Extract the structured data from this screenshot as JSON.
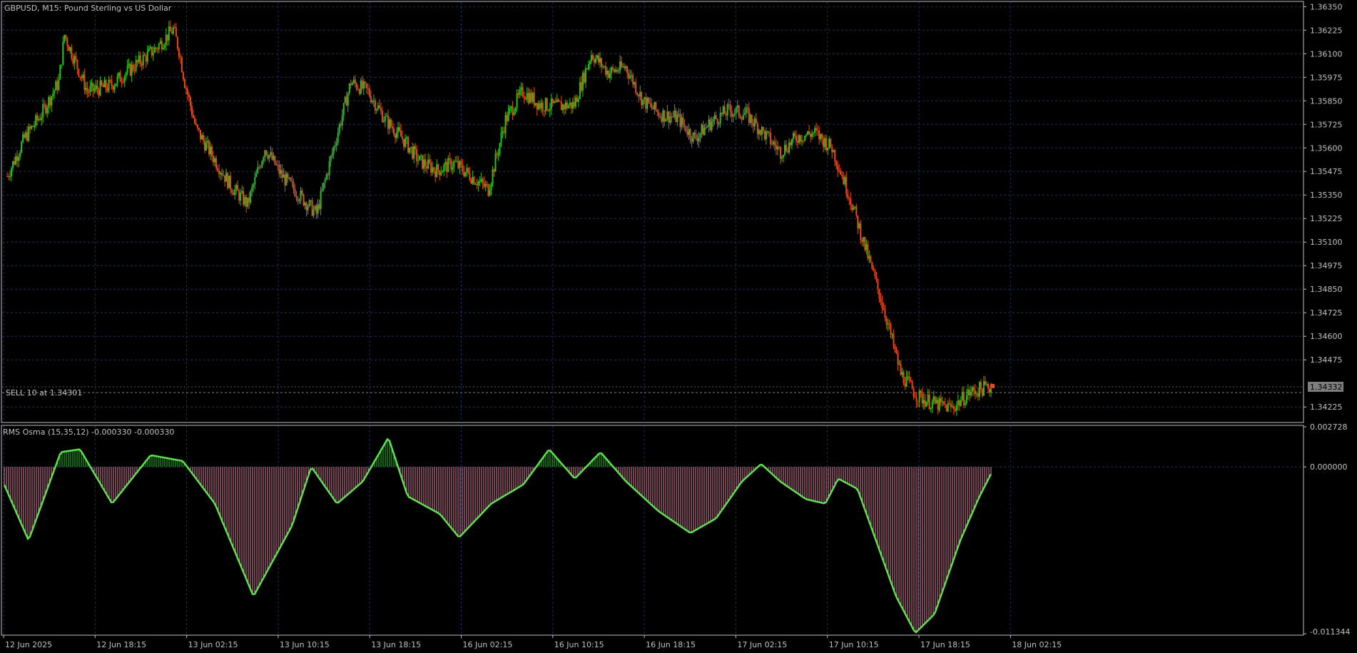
{
  "window": {
    "title": "GBPUSD, M15:  Pound Sterling vs US Dollar"
  },
  "colors": {
    "background": "#000000",
    "grid": "#1a2c66",
    "border": "#c0c0c0",
    "bull": "#22c322",
    "bear": "#e8491d",
    "osma_hist": "#e889a8",
    "osma_line_up": "#5fe04f",
    "osma_line_down": "#ff7fae",
    "text": "#c0c0c0",
    "order_line": "#7a7a7a",
    "price_tag_bg": "#7f7f7f",
    "price_tag_text": "#000000"
  },
  "main_panel": {
    "order_label": "SELL 10 at 1.34301",
    "order_price": 1.34301,
    "current_price": "1.34332",
    "price_axis": [
      "1.36350",
      "1.36225",
      "1.36100",
      "1.35975",
      "1.35850",
      "1.35725",
      "1.35600",
      "1.35475",
      "1.35350",
      "1.35225",
      "1.35100",
      "1.34975",
      "1.34850",
      "1.34725",
      "1.34600",
      "1.34475",
      "1.34225"
    ]
  },
  "indicator_panel": {
    "label": "RMS Osma (15,35,12) -0.000330 -0.000330",
    "axis": [
      "0.002728",
      "0.000000",
      "-0.011344"
    ]
  },
  "time_axis": [
    "12 Jun 2025",
    "12 Jun 18:15",
    "13 Jun 02:15",
    "13 Jun 10:15",
    "13 Jun 18:15",
    "16 Jun 02:15",
    "16 Jun 10:15",
    "16 Jun 18:15",
    "17 Jun 02:15",
    "17 Jun 10:15",
    "17 Jun 18:15",
    "18 Jun 02:15"
  ],
  "chart_data": {
    "type": "candlestick",
    "symbol": "GBPUSD",
    "timeframe": "M15",
    "price_range": [
      1.3415,
      1.3637
    ],
    "close_path": [
      [
        0,
        1.3545
      ],
      [
        3,
        1.3565
      ],
      [
        6,
        1.3578
      ],
      [
        9,
        1.3595
      ],
      [
        10,
        1.362
      ],
      [
        12,
        1.3605
      ],
      [
        14,
        1.359
      ],
      [
        18,
        1.3593
      ],
      [
        22,
        1.3603
      ],
      [
        26,
        1.3613
      ],
      [
        29,
        1.3623
      ],
      [
        30,
        1.3612
      ],
      [
        31,
        1.3595
      ],
      [
        33,
        1.357
      ],
      [
        36,
        1.3555
      ],
      [
        39,
        1.354
      ],
      [
        42,
        1.353
      ],
      [
        45,
        1.356
      ],
      [
        48,
        1.3545
      ],
      [
        51,
        1.3535
      ],
      [
        54,
        1.3525
      ],
      [
        57,
        1.356
      ],
      [
        60,
        1.3595
      ],
      [
        63,
        1.359
      ],
      [
        66,
        1.3575
      ],
      [
        69,
        1.3565
      ],
      [
        72,
        1.3553
      ],
      [
        75,
        1.3548
      ],
      [
        78,
        1.3552
      ],
      [
        81,
        1.3545
      ],
      [
        84,
        1.3538
      ],
      [
        87,
        1.3575
      ],
      [
        90,
        1.359
      ],
      [
        93,
        1.3583
      ],
      [
        96,
        1.3582
      ],
      [
        99,
        1.3583
      ],
      [
        102,
        1.361
      ],
      [
        105,
        1.36
      ],
      [
        108,
        1.3603
      ],
      [
        111,
        1.3585
      ],
      [
        114,
        1.3578
      ],
      [
        117,
        1.3576
      ],
      [
        120,
        1.3565
      ],
      [
        123,
        1.3574
      ],
      [
        126,
        1.358
      ],
      [
        129,
        1.3578
      ],
      [
        132,
        1.3568
      ],
      [
        135,
        1.3558
      ],
      [
        138,
        1.3566
      ],
      [
        141,
        1.3568
      ],
      [
        144,
        1.356
      ],
      [
        147,
        1.3535
      ],
      [
        150,
        1.3505
      ],
      [
        153,
        1.3475
      ],
      [
        156,
        1.344
      ],
      [
        159,
        1.3428
      ],
      [
        162,
        1.3424
      ],
      [
        165,
        1.3422
      ],
      [
        168,
        1.343
      ],
      [
        171,
        1.3433
      ]
    ]
  },
  "osma_data": {
    "range": [
      -0.011344,
      0.002728
    ],
    "path": [
      [
        0,
        -0.001
      ],
      [
        4,
        -0.005
      ],
      [
        9,
        0.001
      ],
      [
        12,
        0.0012
      ],
      [
        17,
        -0.0025
      ],
      [
        23,
        0.0008
      ],
      [
        28,
        0.0004
      ],
      [
        33,
        -0.0025
      ],
      [
        39,
        -0.0088
      ],
      [
        45,
        -0.004
      ],
      [
        48,
        0.0
      ],
      [
        52,
        -0.0025
      ],
      [
        56,
        -0.001
      ],
      [
        60,
        0.002
      ],
      [
        63,
        -0.002
      ],
      [
        68,
        -0.0032
      ],
      [
        71,
        -0.0048
      ],
      [
        76,
        -0.0025
      ],
      [
        81,
        -0.0012
      ],
      [
        85,
        0.0012
      ],
      [
        89,
        -0.0008
      ],
      [
        93,
        0.001
      ],
      [
        97,
        -0.001
      ],
      [
        102,
        -0.003
      ],
      [
        107,
        -0.0045
      ],
      [
        111,
        -0.0035
      ],
      [
        115,
        -0.001
      ],
      [
        118,
        0.0002
      ],
      [
        121,
        -0.001
      ],
      [
        125,
        -0.0022
      ],
      [
        128,
        -0.0025
      ],
      [
        130,
        -0.0008
      ],
      [
        133,
        -0.0015
      ],
      [
        139,
        -0.0088
      ],
      [
        142,
        -0.0113
      ],
      [
        145,
        -0.01
      ],
      [
        149,
        -0.005
      ],
      [
        152,
        -0.002
      ],
      [
        154,
        -0.0003
      ]
    ]
  }
}
